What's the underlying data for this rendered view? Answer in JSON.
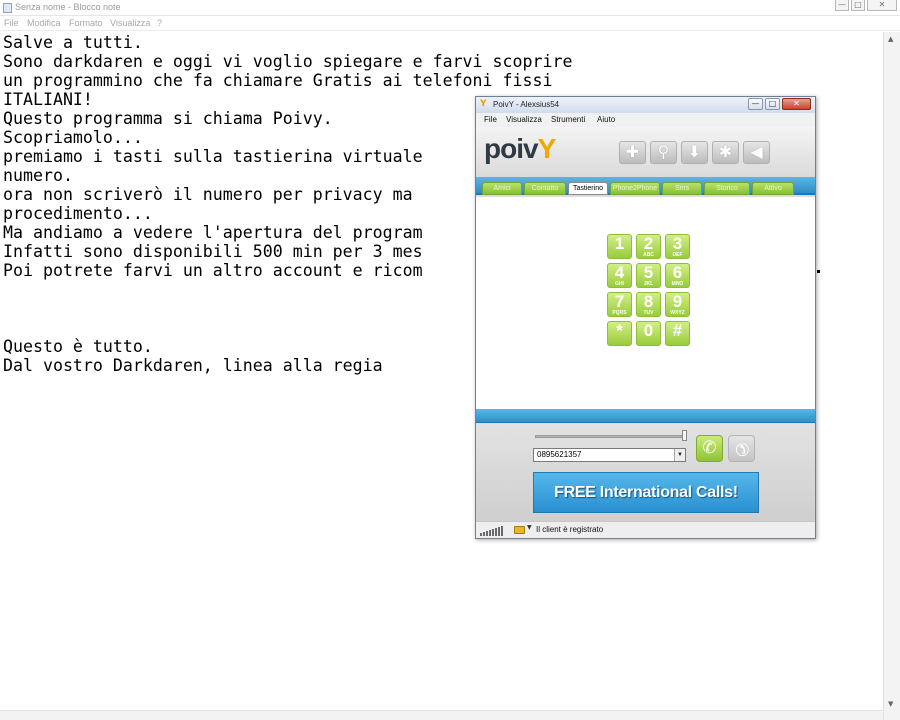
{
  "notepad": {
    "title": "Senza nome - Blocco note",
    "menu": [
      "File",
      "Modifica",
      "Formato",
      "Visualizza",
      "?"
    ],
    "controls": {
      "minimize": "—",
      "maximize": "□",
      "close": "✕"
    },
    "lines": [
      "Salve a tutti.",
      "Sono darkdaren e oggi vi voglio spiegare e farvi scoprire",
      "un programmino che fa chiamare Gratis ai telefoni fissi",
      "ITALIANI!",
      "Questo programma si chiama Poivy.",
      "Scopriamolo...",
      "premiamo i tasti sulla tastierina virtuale",
      "numero.",
      "ora non scriverò il numero per privacy ma",
      "procedimento...",
      "Ma andiamo a vedere l'apertura del program",
      "Infatti sono disponibili 500 min per 3 mes",
      "Poi potrete farvi un altro account e ricom",
      "",
      "",
      "",
      "Questo è tutto.",
      "Dal vostro Darkdaren, linea alla regia"
    ]
  },
  "poivy": {
    "title": "PoivY - Alexsius54",
    "controls": {
      "minimize": "—",
      "maximize": "□",
      "close": "✕"
    },
    "menu": [
      "File",
      "Visualizza",
      "Strumenti",
      "Aiuto"
    ],
    "brand": {
      "main": "poiv",
      "accent": "Y",
      "accent_color": "#f2a800"
    },
    "toolbar": [
      {
        "icon": "add-icon",
        "glyph": "✚"
      },
      {
        "icon": "search-icon",
        "glyph": "⚲"
      },
      {
        "icon": "download-icon",
        "glyph": "⬇"
      },
      {
        "icon": "settings-icon",
        "glyph": "✱"
      },
      {
        "icon": "speaker-icon",
        "glyph": "◀"
      }
    ],
    "tabs": [
      "Amici",
      "Contatto",
      "Tastierino",
      "Phone2Phone",
      "Sms",
      "Storico",
      "Attivo"
    ],
    "active_tab": "Tastierino",
    "keypad": [
      {
        "digit": "1",
        "letters": ""
      },
      {
        "digit": "2",
        "letters": "ABC"
      },
      {
        "digit": "3",
        "letters": "DEF"
      },
      {
        "digit": "4",
        "letters": "GHI"
      },
      {
        "digit": "5",
        "letters": "JKL"
      },
      {
        "digit": "6",
        "letters": "MNO"
      },
      {
        "digit": "7",
        "letters": "PQRS"
      },
      {
        "digit": "8",
        "letters": "TUV"
      },
      {
        "digit": "9",
        "letters": "WXYZ"
      },
      {
        "digit": "*",
        "letters": ""
      },
      {
        "digit": "0",
        "letters": ""
      },
      {
        "digit": "#",
        "letters": ""
      }
    ],
    "number_value": "0895621357",
    "dropdown_glyph": "▼",
    "call_glyph": "✆",
    "hangup_glyph": "✆",
    "banner": "FREE International Calls!",
    "status_arrow": "▼",
    "status_text": "Il client è registrato",
    "accent_green": "#98cc3c",
    "accent_blue": "#2f8dc8"
  }
}
